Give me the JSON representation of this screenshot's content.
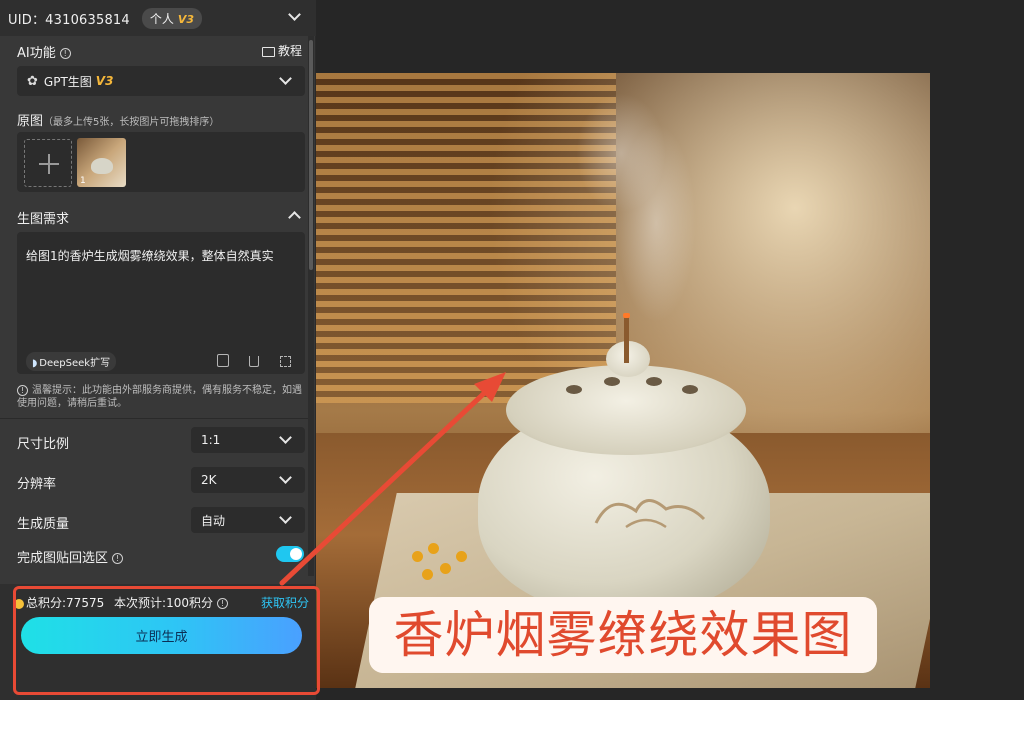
{
  "header": {
    "uid": "UID：4310635814",
    "account_type": "个人",
    "version_badge": "V3"
  },
  "ai_function": {
    "label": "AI功能",
    "tutorial_label": "教程",
    "model_name": "GPT生图",
    "model_version": "V3"
  },
  "source_image": {
    "label": "原图",
    "hint": "（最多上传5张，长按图片可拖拽排序）",
    "thumbnail_index": "1"
  },
  "prompt": {
    "label": "生图需求",
    "text": "给图1的香炉生成烟雾缭绕效果，整体自然真实",
    "deepseek_label": "DeepSeek扩写",
    "notice": "温馨提示：此功能由外部服务商提供，偶有服务不稳定，如遇使用问题，请稍后重试。"
  },
  "settings": {
    "aspect_label": "尺寸比例",
    "aspect_value": "1:1",
    "resolution_label": "分辨率",
    "resolution_value": "2K",
    "quality_label": "生成质量",
    "quality_value": "自动",
    "paste_back_label": "完成图贴回选区",
    "paste_back_enabled": true
  },
  "credits": {
    "total": "总积分:77575",
    "estimate": "本次预计:100积分",
    "get_credits": "获取积分"
  },
  "generate_button": "立即生成",
  "caption": "香炉烟雾缭绕效果图",
  "colors": {
    "panel_bg": "#383838",
    "accent": "#2ec5f5",
    "badge": "#f5b73a",
    "annotation": "#e84a35"
  }
}
